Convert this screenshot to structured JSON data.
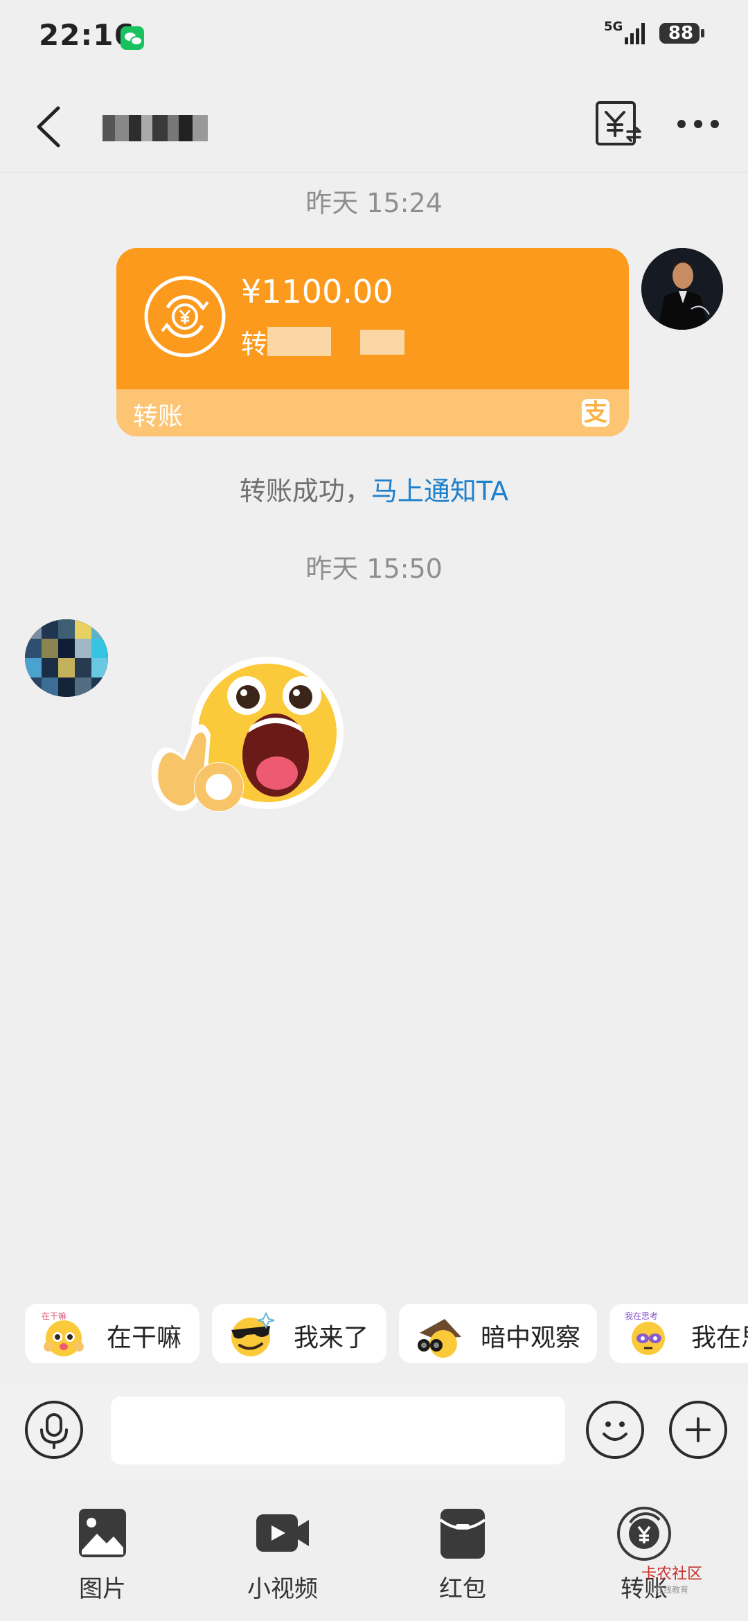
{
  "status_bar": {
    "time": "22:16",
    "network": "5G",
    "battery": "88"
  },
  "header": {
    "back_icon": "chevron-left-icon",
    "bill_icon": "yuan-bill-icon",
    "more_icon": "ellipsis-icon"
  },
  "messages": {
    "time_1": "昨天 15:24",
    "transfer": {
      "amount": "¥1100.00",
      "note_prefix": "转",
      "label": "转账",
      "pay_icon": "支"
    },
    "success_text": "转账成功，",
    "notify_link": "马上通知TA",
    "time_2": "昨天 15:50"
  },
  "quick_replies": [
    {
      "emoji_text": "在干嘛",
      "label": "在干嘛"
    },
    {
      "label": "我来了"
    },
    {
      "label": "暗中观察"
    },
    {
      "emoji_text": "我在思考",
      "label": "我在思"
    }
  ],
  "input": {
    "value": "",
    "placeholder": ""
  },
  "tools": [
    {
      "label": "图片",
      "icon": "image-icon"
    },
    {
      "label": "小视频",
      "icon": "video-icon"
    },
    {
      "label": "红包",
      "icon": "red-packet-icon"
    },
    {
      "label": "转账",
      "icon": "transfer-icon"
    }
  ],
  "watermark": {
    "title": "卡农社区",
    "subtitle": "在线教育"
  },
  "colors": {
    "transfer_orange": "#fc9a1e",
    "transfer_band": "#fdc573",
    "link_blue": "#1f80cc",
    "background": "#efefef"
  }
}
